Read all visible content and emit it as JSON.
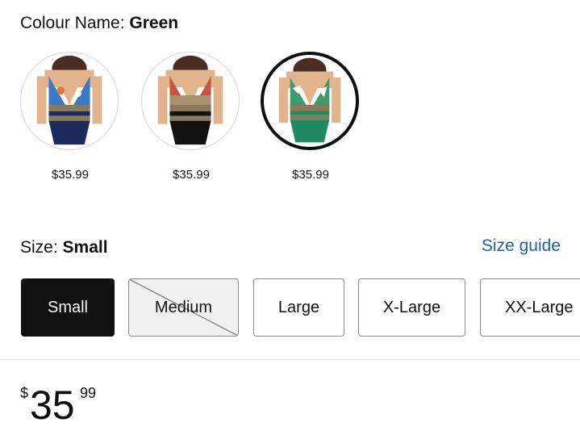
{
  "colour": {
    "label": "Colour Name:",
    "selected": "Green"
  },
  "swatches": [
    {
      "price": "$35.99",
      "bottom_color": "#1d2a5c",
      "top_color": "#3a7bc8",
      "selected": false
    },
    {
      "price": "$35.99",
      "bottom_color": "#111111",
      "top_color": "#c5553e",
      "selected": false
    },
    {
      "price": "$35.99",
      "bottom_color": "#1f8a5f",
      "top_color": "#3c9a6e",
      "selected": true
    }
  ],
  "size": {
    "label": "Size:",
    "selected": "Small",
    "guide_label": "Size guide",
    "options": [
      {
        "label": "Small",
        "state": "selected"
      },
      {
        "label": "Medium",
        "state": "unavailable"
      },
      {
        "label": "Large",
        "state": "available"
      },
      {
        "label": "X-Large",
        "state": "available"
      },
      {
        "label": "XX-Large",
        "state": "available"
      }
    ]
  },
  "price": {
    "symbol": "$",
    "whole": "35",
    "fraction": "99"
  },
  "colors": {
    "link": "#2162a1",
    "selected_button": "#0f1111"
  }
}
